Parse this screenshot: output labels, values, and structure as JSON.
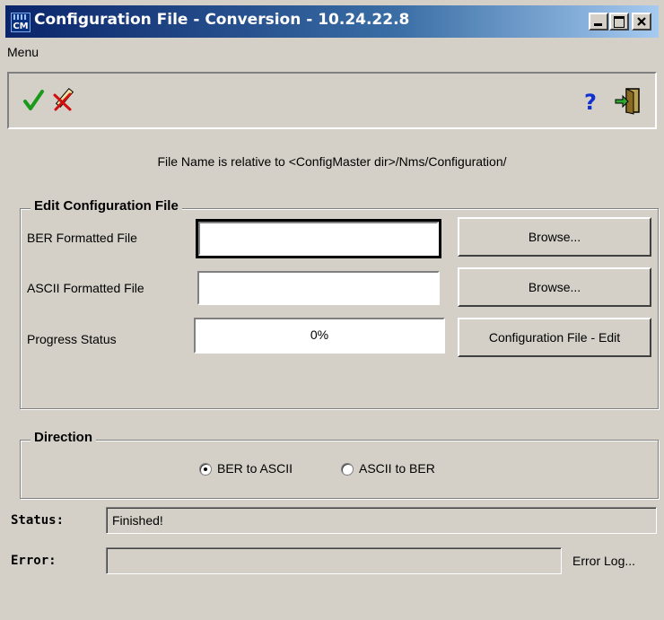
{
  "window": {
    "title": "Configuration File - Conversion - 10.24.22.8",
    "app_icon_text": "CM",
    "controls": [
      "minimize-icon",
      "maximize-icon",
      "close-icon"
    ],
    "title_gradient": [
      "#0a246a",
      "#a6caf0"
    ]
  },
  "menubar": {
    "items": [
      {
        "label": "Menu"
      }
    ]
  },
  "toolbar": {
    "tools": [
      {
        "name": "checkmark-icon",
        "color": "#1a9a1a"
      },
      {
        "name": "eraser-icon",
        "color": "#d01010"
      },
      {
        "name": "help-icon",
        "color": "#1030d0"
      },
      {
        "name": "exit-door-icon",
        "color": "#208020"
      }
    ]
  },
  "info_text": "File Name is relative to <ConfigMaster dir>/Nms/Configuration/",
  "edit_group": {
    "legend": "Edit Configuration File",
    "ber_label": "BER Formatted File",
    "ber_value": "",
    "ascii_label": "ASCII Formatted File",
    "ascii_value": "",
    "progress_label": "Progress Status",
    "progress_value": "0%",
    "browse_label": "Browse...",
    "edit_button_label": "Configuration File - Edit"
  },
  "direction_group": {
    "legend": "Direction",
    "options": [
      {
        "label": "BER to ASCII",
        "selected": true
      },
      {
        "label": "ASCII to BER",
        "selected": false
      }
    ]
  },
  "status": {
    "label": "Status:",
    "value": "Finished!"
  },
  "error": {
    "label": "Error:",
    "value": "",
    "log_label": "Error Log..."
  }
}
